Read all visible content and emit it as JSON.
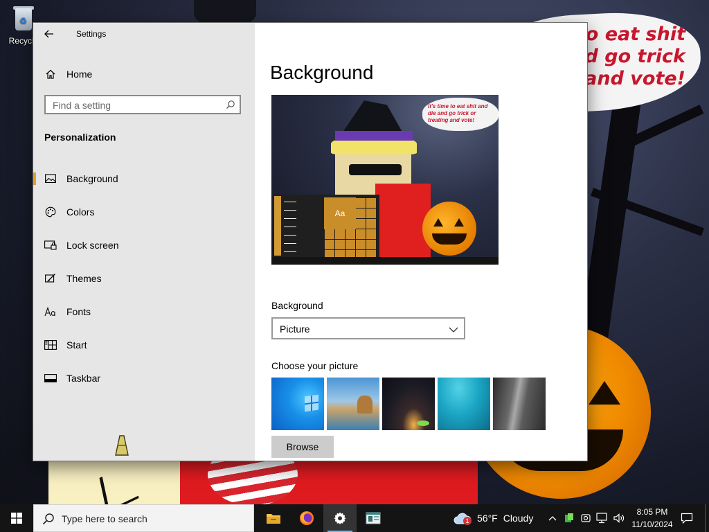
{
  "desktop": {
    "icons": [
      {
        "label": "Recycle"
      }
    ],
    "wallpaper_caption": "o eat shit\nnd go trick\nand vote!"
  },
  "settings_window": {
    "title": "Settings",
    "sidebar": {
      "home_label": "Home",
      "search_placeholder": "Find a setting",
      "section": "Personalization",
      "items": [
        {
          "label": "Background",
          "icon": "picture-icon",
          "selected": true
        },
        {
          "label": "Colors",
          "icon": "palette-icon",
          "selected": false
        },
        {
          "label": "Lock screen",
          "icon": "lock-screen-icon",
          "selected": false
        },
        {
          "label": "Themes",
          "icon": "brush-icon",
          "selected": false
        },
        {
          "label": "Fonts",
          "icon": "font-icon",
          "selected": false
        },
        {
          "label": "Start",
          "icon": "start-grid-icon",
          "selected": false
        },
        {
          "label": "Taskbar",
          "icon": "taskbar-icon",
          "selected": false
        }
      ],
      "accent_color": "#e0a02a"
    },
    "main": {
      "page_title": "Background",
      "preview": {
        "bubble_text": "it's time to eat shit and die and go trick or treating and vote!",
        "tile_label": "Aa"
      },
      "background_label": "Background",
      "background_value": "Picture",
      "choose_picture_label": "Choose your picture",
      "pictures": [
        "windows-default-blue",
        "beach-rock-arch",
        "night-sky-tent",
        "underwater-swimmer",
        "rock-cliff"
      ],
      "browse_label": "Browse"
    }
  },
  "taskbar": {
    "search_placeholder": "Type here to search",
    "pinned_apps": [
      {
        "name": "file-explorer-icon",
        "active": false
      },
      {
        "name": "firefox-icon",
        "active": false
      },
      {
        "name": "settings-gear-icon",
        "active": true
      },
      {
        "name": "app-window-icon",
        "active": false
      }
    ],
    "weather": {
      "temp": "56°F",
      "condition": "Cloudy",
      "badge": "1"
    },
    "time": "8:05 PM",
    "date": "11/10/2024"
  }
}
